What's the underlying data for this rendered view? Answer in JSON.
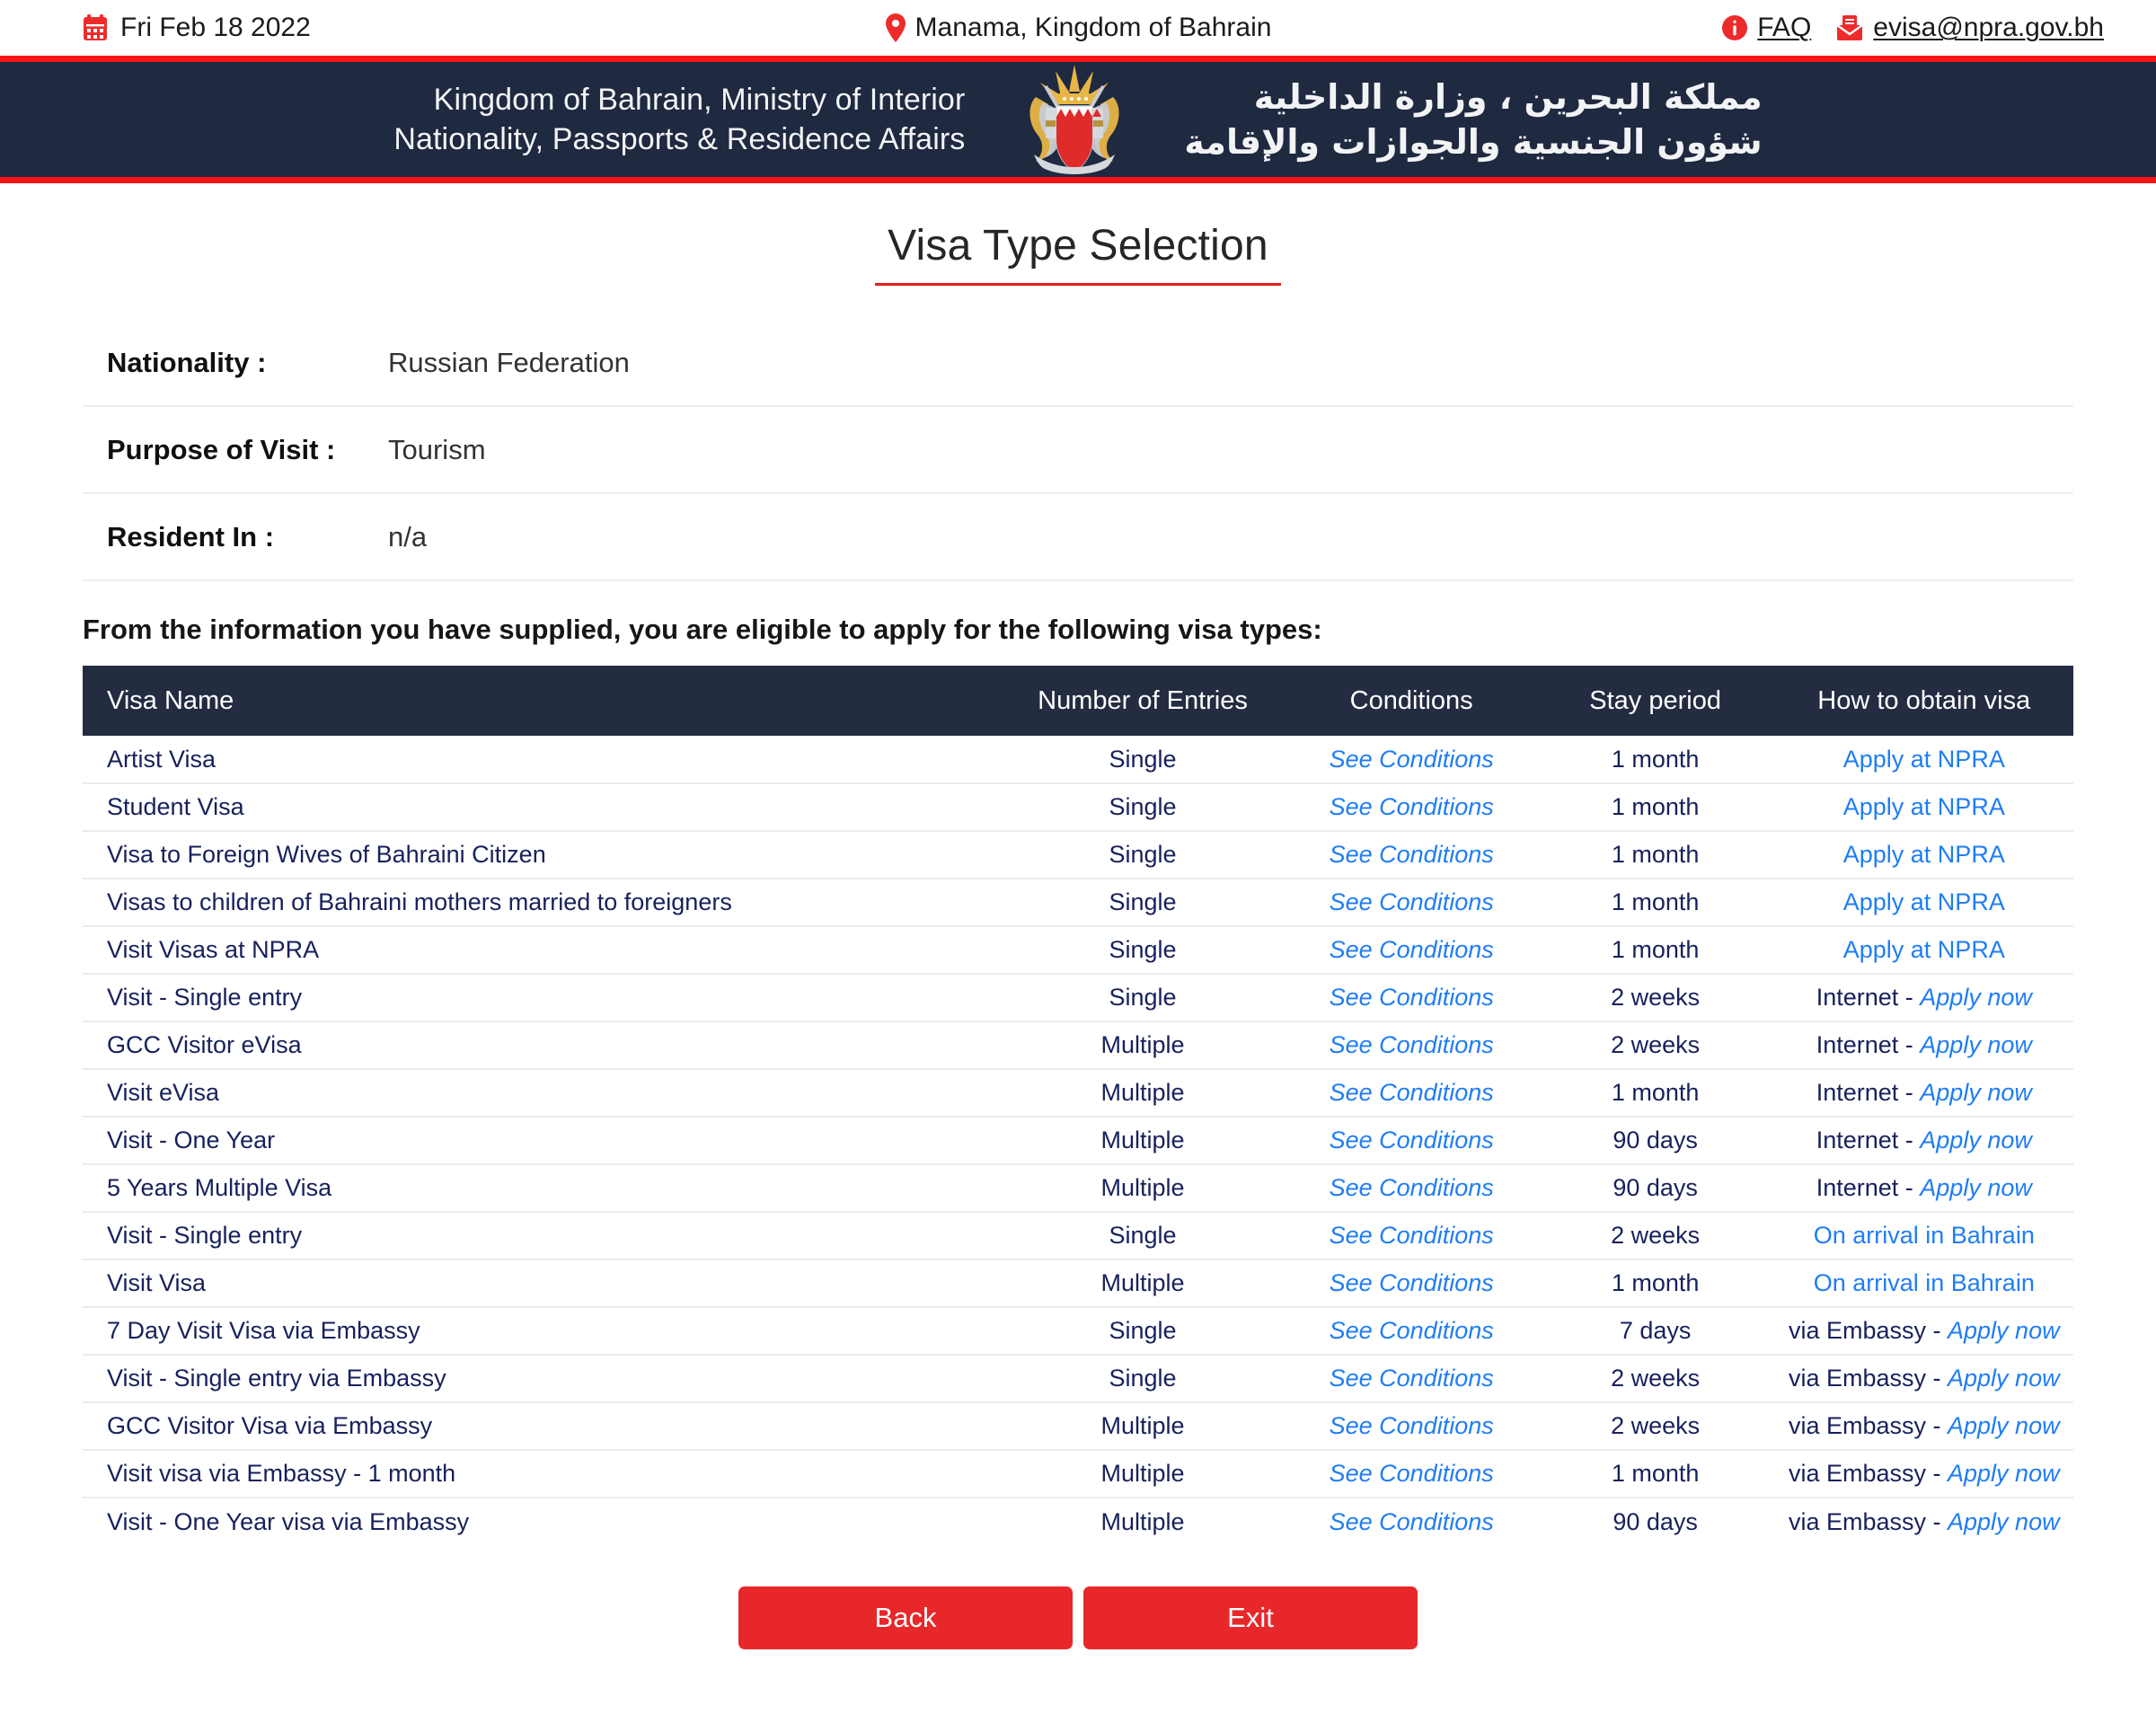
{
  "topbar": {
    "date": "Fri Feb 18 2022",
    "date_icon": "calendar-icon",
    "location": "Manama, Kingdom of Bahrain",
    "location_icon": "map-pin-icon",
    "faq_label": "FAQ",
    "faq_icon": "info-circle-icon",
    "email": "evisa@npra.gov.bh",
    "email_icon": "envelope-icon"
  },
  "brand": {
    "en_line1": "Kingdom of Bahrain, Ministry of Interior",
    "en_line2": "Nationality, Passports & Residence Affairs",
    "ar_line1": "مملكة البحرين ، وزارة الداخلية",
    "ar_line2": "شؤون الجنسية والجوازات والإقامة",
    "emblem_icon": "bahrain-coat-of-arms-icon",
    "accent_red": "#f31515",
    "navy": "#1f2940"
  },
  "page": {
    "title": "Visa Type Selection",
    "eligibility_note": "From the information you have supplied, you are eligible to apply for the following visa types:"
  },
  "summary": [
    {
      "label": "Nationality :",
      "value": "Russian Federation"
    },
    {
      "label": "Purpose of Visit :",
      "value": "Tourism"
    },
    {
      "label": "Resident In :",
      "value": "n/a"
    }
  ],
  "table": {
    "headers": {
      "name": "Visa Name",
      "entries": "Number of Entries",
      "conditions": "Conditions",
      "stay": "Stay period",
      "obtain": "How to obtain visa"
    },
    "conditions_label": "See Conditions",
    "rows": [
      {
        "name": "Artist Visa",
        "entries": "Single",
        "conditions": "See Conditions",
        "stay": "1 month",
        "obtain_prefix": "",
        "obtain_link": "Apply at NPRA"
      },
      {
        "name": "Student Visa",
        "entries": "Single",
        "conditions": "See Conditions",
        "stay": "1 month",
        "obtain_prefix": "",
        "obtain_link": "Apply at NPRA"
      },
      {
        "name": "Visa to Foreign Wives of Bahraini Citizen",
        "entries": "Single",
        "conditions": "See Conditions",
        "stay": "1 month",
        "obtain_prefix": "",
        "obtain_link": "Apply at NPRA"
      },
      {
        "name": "Visas to children of Bahraini mothers married to foreigners",
        "entries": "Single",
        "conditions": "See Conditions",
        "stay": "1 month",
        "obtain_prefix": "",
        "obtain_link": "Apply at NPRA"
      },
      {
        "name": "Visit Visas at NPRA",
        "entries": "Single",
        "conditions": "See Conditions",
        "stay": "1 month",
        "obtain_prefix": "",
        "obtain_link": "Apply at NPRA"
      },
      {
        "name": "Visit - Single entry",
        "entries": "Single",
        "conditions": "See Conditions",
        "stay": "2 weeks",
        "obtain_prefix": "Internet - ",
        "obtain_link": "Apply now"
      },
      {
        "name": "GCC Visitor eVisa",
        "entries": "Multiple",
        "conditions": "See Conditions",
        "stay": "2 weeks",
        "obtain_prefix": "Internet - ",
        "obtain_link": "Apply now"
      },
      {
        "name": "Visit eVisa",
        "entries": "Multiple",
        "conditions": "See Conditions",
        "stay": "1 month",
        "obtain_prefix": "Internet - ",
        "obtain_link": "Apply now"
      },
      {
        "name": "Visit - One Year",
        "entries": "Multiple",
        "conditions": "See Conditions",
        "stay": "90 days",
        "obtain_prefix": "Internet - ",
        "obtain_link": "Apply now"
      },
      {
        "name": "5 Years Multiple Visa",
        "entries": "Multiple",
        "conditions": "See Conditions",
        "stay": "90 days",
        "obtain_prefix": "Internet - ",
        "obtain_link": "Apply now"
      },
      {
        "name": "Visit - Single entry",
        "entries": "Single",
        "conditions": "See Conditions",
        "stay": "2 weeks",
        "obtain_prefix": "",
        "obtain_link": "On arrival in Bahrain"
      },
      {
        "name": "Visit Visa",
        "entries": "Multiple",
        "conditions": "See Conditions",
        "stay": "1 month",
        "obtain_prefix": "",
        "obtain_link": "On arrival in Bahrain"
      },
      {
        "name": "7 Day Visit Visa via Embassy",
        "entries": "Single",
        "conditions": "See Conditions",
        "stay": "7 days",
        "obtain_prefix": "via Embassy - ",
        "obtain_link": "Apply now"
      },
      {
        "name": "Visit - Single entry via Embassy",
        "entries": "Single",
        "conditions": "See Conditions",
        "stay": "2 weeks",
        "obtain_prefix": "via Embassy - ",
        "obtain_link": "Apply now"
      },
      {
        "name": "GCC Visitor Visa via Embassy",
        "entries": "Multiple",
        "conditions": "See Conditions",
        "stay": "2 weeks",
        "obtain_prefix": "via Embassy - ",
        "obtain_link": "Apply now"
      },
      {
        "name": "Visit visa via Embassy - 1 month",
        "entries": "Multiple",
        "conditions": "See Conditions",
        "stay": "1 month",
        "obtain_prefix": "via Embassy - ",
        "obtain_link": "Apply now"
      },
      {
        "name": "Visit - One Year visa via Embassy",
        "entries": "Multiple",
        "conditions": "See Conditions",
        "stay": "90 days",
        "obtain_prefix": "via Embassy - ",
        "obtain_link": "Apply now"
      }
    ]
  },
  "buttons": {
    "back": "Back",
    "exit": "Exit",
    "color": "#e8272b"
  }
}
